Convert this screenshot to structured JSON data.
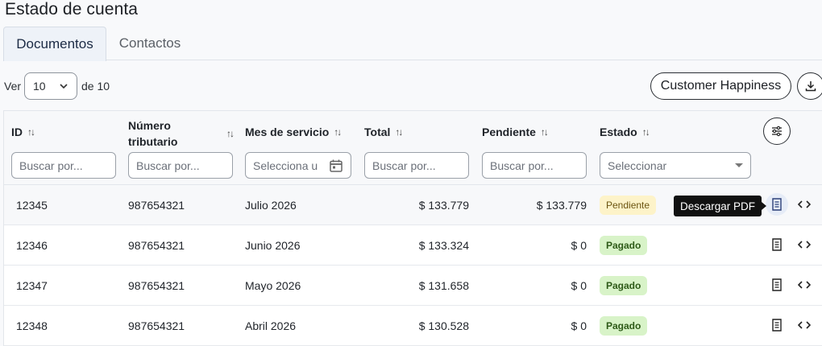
{
  "page": {
    "title": "Estado de cuenta"
  },
  "tabs": [
    {
      "label": "Documentos",
      "active": true
    },
    {
      "label": "Contactos",
      "active": false
    }
  ],
  "pager": {
    "prefix": "Ver",
    "value": "10",
    "suffix": "de 10"
  },
  "actions": {
    "customer_happiness": "Customer Happiness",
    "download_icon": "download-icon"
  },
  "table": {
    "columns": [
      {
        "label": "ID",
        "filter_placeholder": "Buscar por..."
      },
      {
        "label": "Número\ntributario",
        "filter_placeholder": "Buscar por..."
      },
      {
        "label": "Mes de servicio",
        "filter_placeholder": "Selecciona u"
      },
      {
        "label": "Total",
        "filter_placeholder": "Buscar por..."
      },
      {
        "label": "Pendiente",
        "filter_placeholder": "Buscar por..."
      },
      {
        "label": "Estado",
        "filter_placeholder": "Seleccionar"
      }
    ],
    "rows": [
      {
        "id": "12345",
        "tax_number": "987654321",
        "month": "Julio 2026",
        "total": "$ 133.779",
        "pending": "$ 133.779",
        "status": "Pendiente"
      },
      {
        "id": "12346",
        "tax_number": "987654321",
        "month": "Junio 2026",
        "total": "$ 133.324",
        "pending": "$ 0",
        "status": "Pagado"
      },
      {
        "id": "12347",
        "tax_number": "987654321",
        "month": "Mayo 2026",
        "total": "$ 131.658",
        "pending": "$ 0",
        "status": "Pagado"
      },
      {
        "id": "12348",
        "tax_number": "987654321",
        "month": "Abril 2026",
        "total": "$ 130.528",
        "pending": "$ 0",
        "status": "Pagado"
      }
    ]
  },
  "tooltip": {
    "text": "Descargar PDF"
  },
  "colors": {
    "pending_badge": "#fdf3c9",
    "paid_badge": "#d8f3c8",
    "active_tab": "#eef2f8"
  }
}
